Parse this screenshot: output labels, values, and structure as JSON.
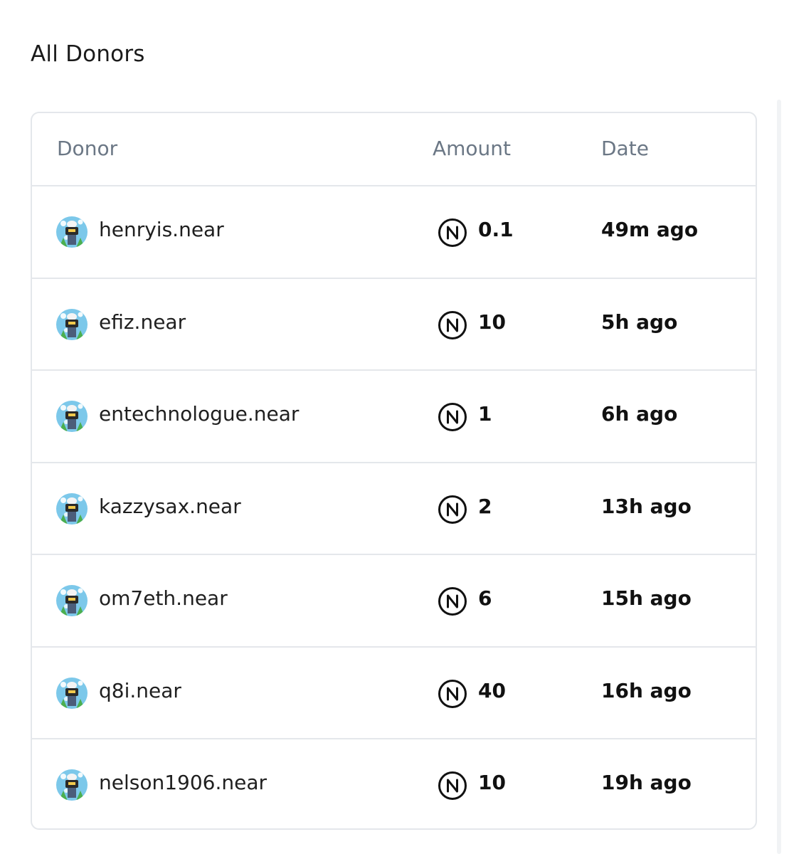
{
  "page_title": "All Donors",
  "table": {
    "headers": {
      "donor": "Donor",
      "amount": "Amount",
      "date": "Date"
    },
    "rows": [
      {
        "donor": "henryis.near",
        "amount": "0.1",
        "date": "49m ago"
      },
      {
        "donor": "efiz.near",
        "amount": "10",
        "date": "5h ago"
      },
      {
        "donor": "entechnologue.near",
        "amount": "1",
        "date": "6h ago"
      },
      {
        "donor": "kazzysax.near",
        "amount": "2",
        "date": "13h ago"
      },
      {
        "donor": "om7eth.near",
        "amount": "6",
        "date": "15h ago"
      },
      {
        "donor": "q8i.near",
        "amount": "40",
        "date": "16h ago"
      },
      {
        "donor": "nelson1906.near",
        "amount": "10",
        "date": "19h ago"
      }
    ]
  },
  "icons": {
    "amount_icon": "near-token-icon",
    "avatar": "default-avatar-icon"
  },
  "colors": {
    "border": "#e4e7eb",
    "header_text": "#6b7785",
    "text": "#111111",
    "avatar_sky": "#7cc8ea"
  }
}
